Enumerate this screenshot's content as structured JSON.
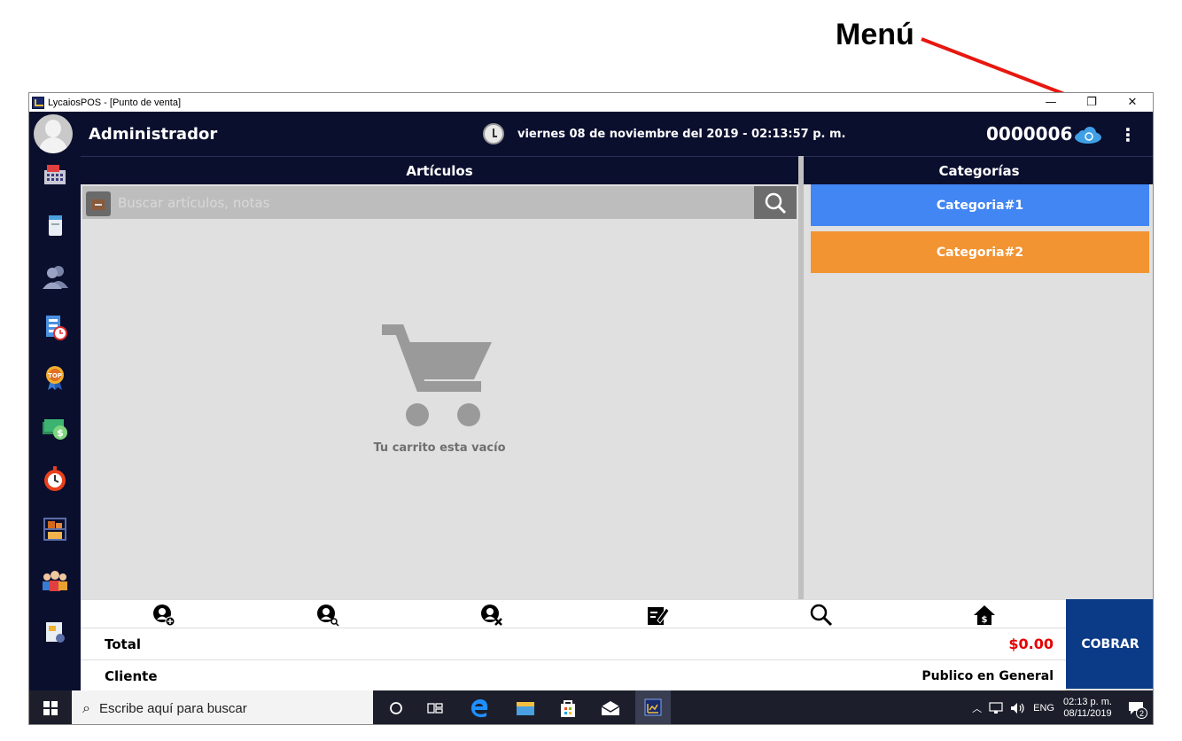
{
  "annotation": {
    "label": "Menú",
    "arrow_color": "#e8170f"
  },
  "window": {
    "title": "LycaiosPOS - [Punto de venta]",
    "controls": {
      "minimize": "—",
      "maximize": "❐",
      "close": "✕"
    }
  },
  "header": {
    "user_name": "Administrador",
    "datetime": "viernes 08 de noviembre del 2019 - 02:13:57 p. m.",
    "folio": "0000006",
    "cloud_icon": "cloud-sync-icon",
    "menu_icon": "kebab-menu-icon",
    "menu_glyph": "⋮"
  },
  "sidebar": {
    "items": [
      {
        "name": "sales-register",
        "icon": "cash-register-icon"
      },
      {
        "name": "notes",
        "icon": "notepad-icon"
      },
      {
        "name": "clients",
        "icon": "users-icon"
      },
      {
        "name": "reports",
        "icon": "report-clock-icon"
      },
      {
        "name": "top",
        "icon": "top-badge-icon"
      },
      {
        "name": "money",
        "icon": "money-icon"
      },
      {
        "name": "timer",
        "icon": "stopwatch-icon"
      },
      {
        "name": "inventory",
        "icon": "warehouse-shelf-icon"
      },
      {
        "name": "employees",
        "icon": "employees-icon"
      },
      {
        "name": "settings",
        "icon": "document-settings-icon"
      }
    ]
  },
  "articles": {
    "title": "Artículos",
    "search_placeholder": "Buscar artículos, notas",
    "empty_cart_text": "Tu carrito esta vacío"
  },
  "categories": {
    "title": "Categorías",
    "items": [
      {
        "label": "Categoria#1",
        "color": "#4286f4"
      },
      {
        "label": "Categoria#2",
        "color": "#f29432"
      }
    ]
  },
  "actions": [
    {
      "name": "add-client-button",
      "icon": "user-add-icon"
    },
    {
      "name": "search-client-button",
      "icon": "user-search-icon"
    },
    {
      "name": "remove-client-button",
      "icon": "user-remove-icon"
    },
    {
      "name": "edit-note-button",
      "icon": "edit-note-icon"
    },
    {
      "name": "search-button",
      "icon": "search-icon"
    },
    {
      "name": "home-price-button",
      "icon": "house-dollar-icon"
    }
  ],
  "summary": {
    "total_label": "Total",
    "total_value": "$0.00",
    "client_label": "Cliente",
    "client_value": "Publico en General",
    "charge_label": "COBRAR"
  },
  "taskbar": {
    "search_text": "Escribe aquí para buscar",
    "language": "ENG",
    "time": "02:13 p. m.",
    "date": "08/11/2019",
    "notifications": "2"
  }
}
